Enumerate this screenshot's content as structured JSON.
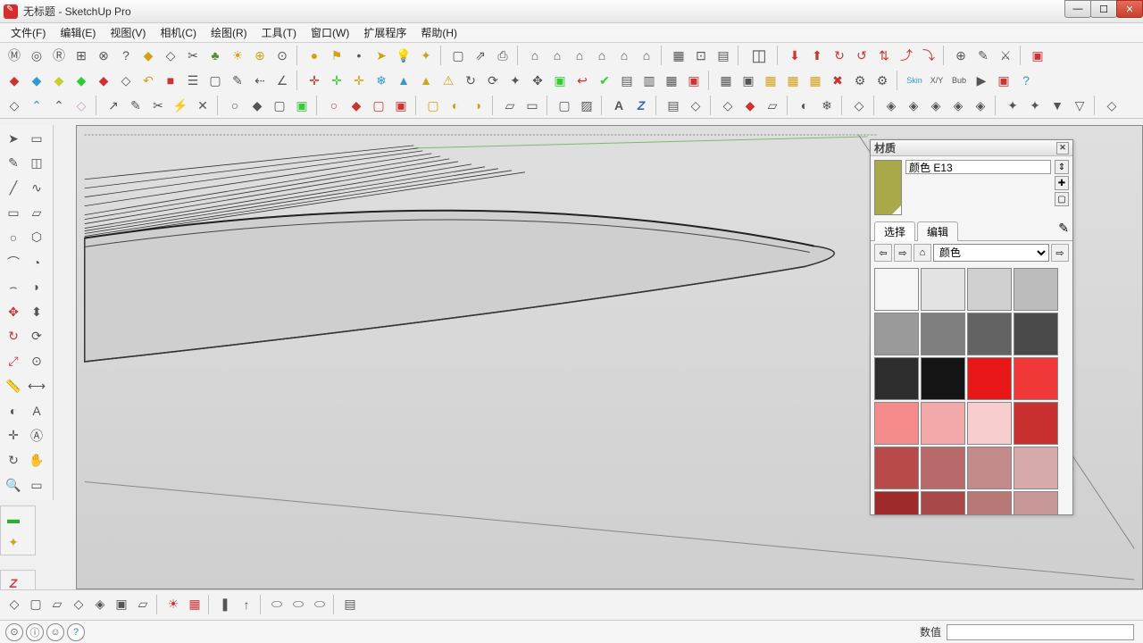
{
  "window": {
    "title": "无标题 - SketchUp Pro"
  },
  "menu": {
    "file": "文件(F)",
    "edit": "编辑(E)",
    "view": "视图(V)",
    "camera": "相机(C)",
    "drawing": "绘图(R)",
    "tools": "工具(T)",
    "window": "窗口(W)",
    "extensions": "扩展程序",
    "help": "帮助(H)"
  },
  "materials": {
    "title": "材质",
    "current_name": "颜色 E13",
    "tab_select": "选择",
    "tab_edit": "编辑",
    "category": "颜色",
    "preview_color": "#a9a949",
    "swatches": [
      "#f5f5f5",
      "#e3e3e3",
      "#d0d0d0",
      "#bcbcbc",
      "#9a9a9a",
      "#7f7f7f",
      "#636363",
      "#4a4a4a",
      "#2d2d2d",
      "#141414",
      "#e81717",
      "#f03838",
      "#f58a8a",
      "#f3a9a9",
      "#f7cdcd",
      "#c82f2f",
      "#b84a4a",
      "#b86a6a",
      "#c28a8a",
      "#d6aaaa",
      "#9e2a2a",
      "#a84848",
      "#b87878",
      "#c89898"
    ]
  },
  "status": {
    "value_label": "数值"
  }
}
